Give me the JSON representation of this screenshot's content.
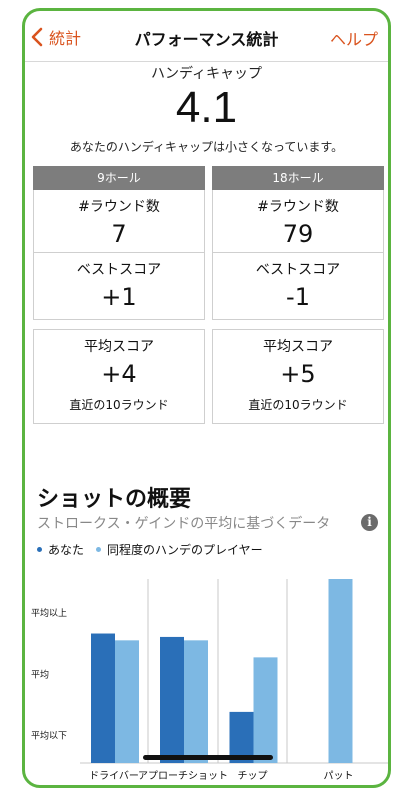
{
  "nav": {
    "back_label": "統計",
    "title": "パフォーマンス統計",
    "help_label": "ヘルプ"
  },
  "handicap": {
    "label": "ハンディキャップ",
    "value": "4.1",
    "note": "あなたのハンディキャップは小さくなっています。"
  },
  "cards": [
    {
      "header": "9ホール",
      "rounds_label": "#ラウンド数",
      "rounds_value": "7",
      "best_label": "ベストスコア",
      "best_value": "+1",
      "avg_label": "平均スコア",
      "avg_value": "+4",
      "avg_sub": "直近の10ラウンド"
    },
    {
      "header": "18ホール",
      "rounds_label": "#ラウンド数",
      "rounds_value": "79",
      "best_label": "ベストスコア",
      "best_value": "-1",
      "avg_label": "平均スコア",
      "avg_value": "+5",
      "avg_sub": "直近の10ラウンド"
    }
  ],
  "shots": {
    "title": "ショットの概要",
    "subtitle": "ストロークス・ゲインドの平均に基づくデータ",
    "info_icon": "info-icon"
  },
  "colors": {
    "accent": "#d9531e",
    "frame": "#5bb440",
    "you": "#2a6fb8",
    "peers": "#7db8e3",
    "header_gray": "#7d7d7d"
  },
  "chart_data": {
    "type": "bar",
    "categories": [
      "ドライバー",
      "アプローチショット",
      "チップ",
      "パット"
    ],
    "series": [
      {
        "name": "あなた",
        "values": [
          0.6,
          0.55,
          -0.55,
          null
        ]
      },
      {
        "name": "同程度のハンデのプレイヤー",
        "values": [
          0.5,
          0.5,
          0.25,
          1.4
        ]
      }
    ],
    "y_ticks": [
      {
        "label": "平均以上",
        "value": 0.9
      },
      {
        "label": "平均",
        "value": 0
      },
      {
        "label": "平均以下",
        "value": -0.9
      }
    ],
    "ylim": [
      -1.3,
      1.4
    ],
    "legend": "top-left",
    "grid": "vertical separators"
  }
}
